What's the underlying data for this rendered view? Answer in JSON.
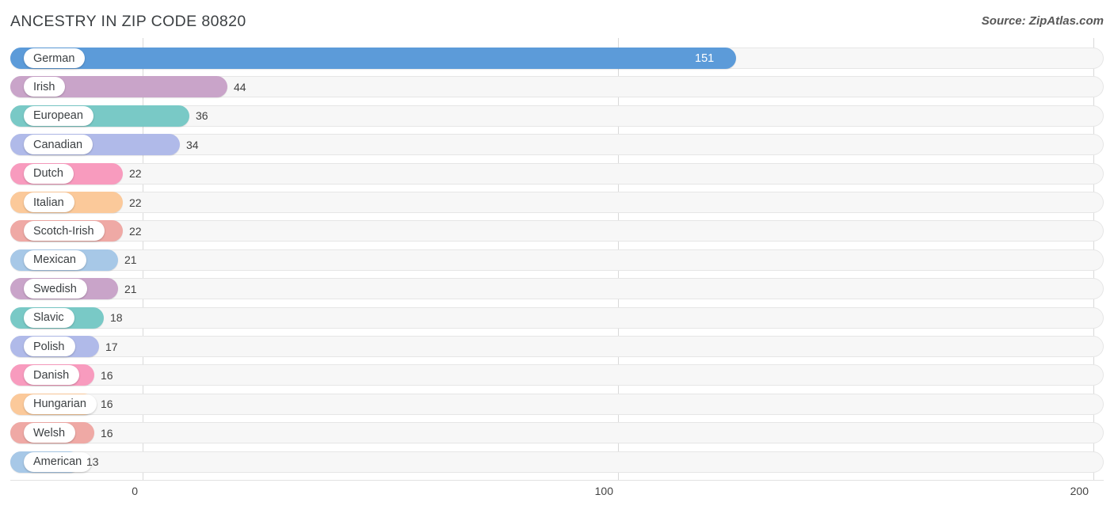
{
  "header": {
    "title": "ANCESTRY IN ZIP CODE 80820",
    "source": "Source: ZipAtlas.com"
  },
  "chart_data": {
    "type": "bar",
    "orientation": "horizontal",
    "title": "ANCESTRY IN ZIP CODE 80820",
    "xlabel": "",
    "ylabel": "",
    "xlim": [
      0,
      200
    ],
    "xticks": [
      "0",
      "100",
      "200"
    ],
    "grid": true,
    "legend": "none",
    "categories": [
      "German",
      "Irish",
      "European",
      "Canadian",
      "Dutch",
      "Italian",
      "Scotch-Irish",
      "Mexican",
      "Swedish",
      "Slavic",
      "Polish",
      "Danish",
      "Hungarian",
      "Welsh",
      "American"
    ],
    "values": [
      151,
      44,
      36,
      34,
      22,
      22,
      22,
      21,
      21,
      18,
      17,
      16,
      16,
      16,
      13
    ],
    "value_labels": [
      "151",
      "44",
      "36",
      "34",
      "22",
      "22",
      "22",
      "21",
      "21",
      "18",
      "17",
      "16",
      "16",
      "16",
      "13"
    ],
    "colors": [
      "#5c9bd9",
      "#c9a4c9",
      "#79c9c6",
      "#b0bae9",
      "#f89bbe",
      "#fbc99a",
      "#efa9a5",
      "#a7c8e7",
      "#c9a4c9",
      "#79c9c6",
      "#b0bae9",
      "#f89bbe",
      "#fbc99a",
      "#efa9a5",
      "#a7c8e7"
    ],
    "label_inside": [
      true,
      false,
      false,
      false,
      false,
      false,
      false,
      false,
      false,
      false,
      false,
      false,
      false,
      false,
      false
    ]
  },
  "axis": {
    "ticks": [
      {
        "label": "0",
        "value": 0
      },
      {
        "label": "100",
        "value": 100
      },
      {
        "label": "200",
        "value": 200
      }
    ]
  }
}
